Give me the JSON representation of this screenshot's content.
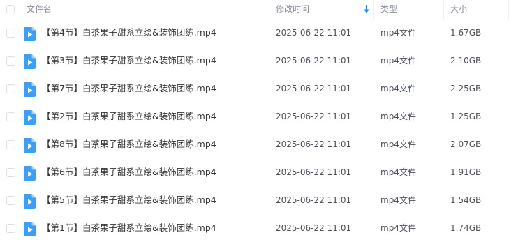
{
  "header": {
    "name_label": "文件名",
    "modified_label": "修改时间",
    "type_label": "类型",
    "size_label": "大小",
    "sort_icon": "arrow-down-icon"
  },
  "colors": {
    "accent": "#1a8cff",
    "file_icon": "#3d9ef5",
    "header_text": "#878c9c",
    "text": "#333333"
  },
  "file_icon": "video-file-icon",
  "files": [
    {
      "name": "【第4节】白茶果子甜系立绘&装饰团练.mp4",
      "modified": "2025-06-22 11:01",
      "type": "mp4文件",
      "size": "1.67GB"
    },
    {
      "name": "【第3节】白茶果子甜系立绘&装饰团练.mp4",
      "modified": "2025-06-22 11:01",
      "type": "mp4文件",
      "size": "2.10GB"
    },
    {
      "name": "【第7节】白茶果子甜系立绘&装饰团练.mp4",
      "modified": "2025-06-22 11:01",
      "type": "mp4文件",
      "size": "2.25GB"
    },
    {
      "name": "【第2节】白茶果子甜系立绘&装饰团练.mp4",
      "modified": "2025-06-22 11:01",
      "type": "mp4文件",
      "size": "1.25GB"
    },
    {
      "name": "【第8节】白茶果子甜系立绘&装饰团练.mp4",
      "modified": "2025-06-22 11:01",
      "type": "mp4文件",
      "size": "2.07GB"
    },
    {
      "name": "【第6节】白茶果子甜系立绘&装饰团练.mp4",
      "modified": "2025-06-22 11:01",
      "type": "mp4文件",
      "size": "1.91GB"
    },
    {
      "name": "【第5节】白茶果子甜系立绘&装饰团练.mp4",
      "modified": "2025-06-22 11:01",
      "type": "mp4文件",
      "size": "1.54GB"
    },
    {
      "name": "【第1节】白茶果子甜系立绘&装饰团练.mp4",
      "modified": "2025-06-22 11:01",
      "type": "mp4文件",
      "size": "1.74GB"
    }
  ]
}
